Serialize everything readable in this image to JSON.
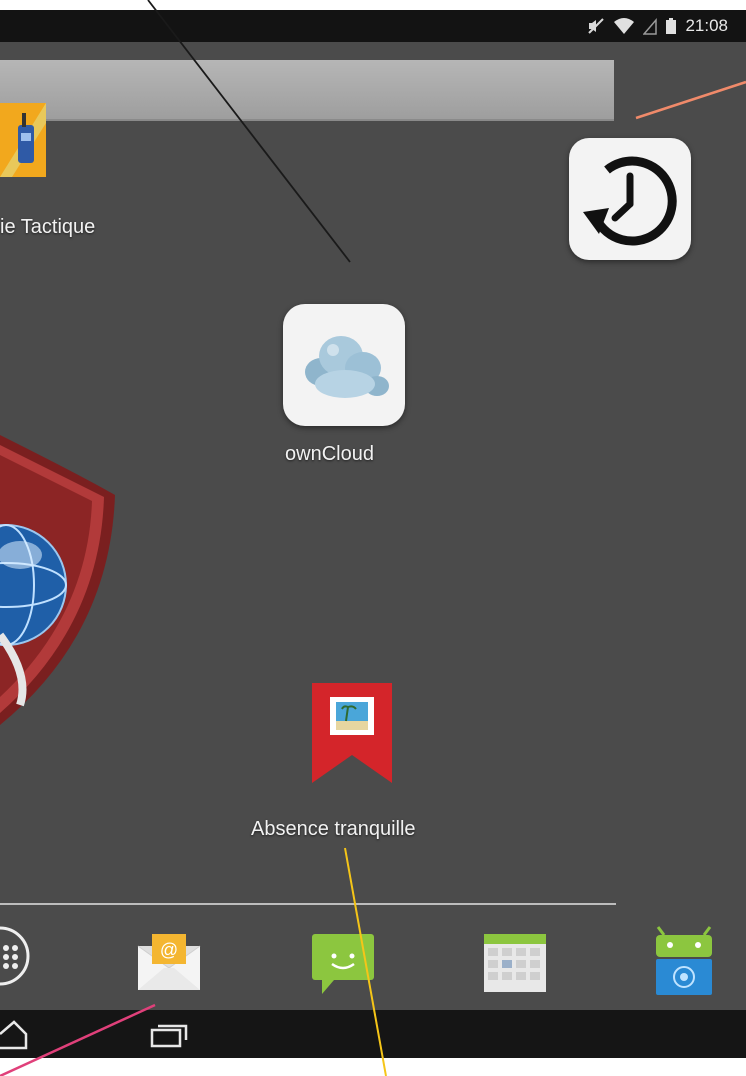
{
  "status_bar": {
    "time": "21:08",
    "icons": [
      "mute-icon",
      "wifi-icon",
      "signal-icon",
      "battery-icon"
    ]
  },
  "home": {
    "apps": [
      {
        "label": "ie Tactique",
        "icon": "tactical-radio-app-icon"
      },
      {
        "label": "ownCloud",
        "icon": "owncloud-app-icon"
      },
      {
        "label": "Absence tranquille",
        "icon": "absence-tranquille-app-icon"
      }
    ],
    "widgets": [
      "restore-clock-icon",
      "security-shield-globe-icon"
    ]
  },
  "dock": {
    "items": [
      "app-drawer-icon",
      "email-app-icon",
      "messaging-app-icon",
      "calendar-app-icon",
      "android-app-icon"
    ]
  },
  "nav_bar": {
    "items": [
      "home-nav-icon",
      "recent-apps-nav-icon"
    ]
  },
  "colors": {
    "callout_black": "#1a1a1a",
    "callout_orange": "#f08a6a",
    "callout_pink": "#e0407a",
    "callout_yellow": "#f5c518"
  }
}
